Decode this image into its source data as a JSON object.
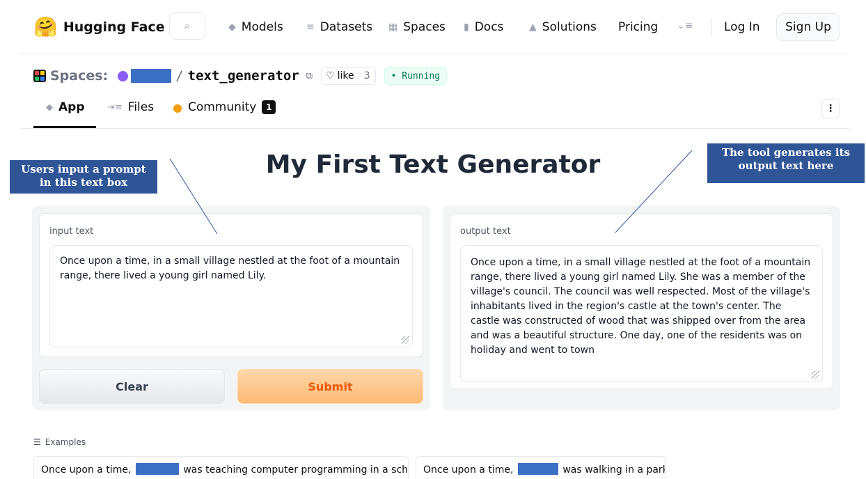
{
  "nav": {
    "brand_logo": "🤗",
    "brand": "Hugging Face",
    "search_icon": "⌕",
    "links": [
      {
        "icon": "◆",
        "label": "Models"
      },
      {
        "icon": "≡",
        "label": "Datasets"
      },
      {
        "icon": "▦",
        "label": "Spaces"
      },
      {
        "icon": "▮",
        "label": "Docs"
      },
      {
        "icon": "▲",
        "label": "Solutions"
      },
      {
        "icon": "",
        "label": "Pricing"
      }
    ],
    "more_icon": "⌄≡",
    "login": "Log In",
    "signup": "Sign Up"
  },
  "space": {
    "label": "Spaces:",
    "slash": "/",
    "name": "text_generator",
    "copy_icon": "⧉",
    "like_label": "like",
    "like_icon": "♡",
    "like_count": "3",
    "status": "• Running",
    "tabs": [
      {
        "icon": "◆",
        "label": "App"
      },
      {
        "icon": "⇥≡",
        "label": "Files"
      },
      {
        "icon": "●",
        "label": "Community"
      }
    ],
    "community_count": "1",
    "kebab": "⋮"
  },
  "app": {
    "title": "My First Text Generator",
    "input_label": "input text",
    "input_text": "Once upon a time, in a small village nestled at the foot of a mountain range, there lived a young girl named Lily.",
    "output_label": "output text",
    "output_text": "Once upon a time, in a small village nestled at the foot of a mountain range, there lived a young girl named Lily.  She was a member of the village's council.  The council was well respected.  Most of the village's inhabitants lived in the region's castle at the town's center.  The castle was constructed of wood that was shipped over from the area and was a beautiful structure.   One day, one of the residents was on holiday and went to town",
    "clear": "Clear",
    "submit": "Submit"
  },
  "annotations": {
    "left": "Users input a prompt in this text box",
    "right": "The tool generates its output text here"
  },
  "examples": {
    "icon": "☰",
    "label": "Examples",
    "items": [
      {
        "before": "Once upon a time,",
        "after": "was teaching computer programming in a school."
      },
      {
        "before": "Once upon a time,",
        "after": "was walking in a park. He"
      }
    ]
  },
  "colors": {
    "annotation_bg": "#2f5597",
    "redaction": "#3b6fc4",
    "submit_text": "#ea580c",
    "running_text": "#047857"
  }
}
